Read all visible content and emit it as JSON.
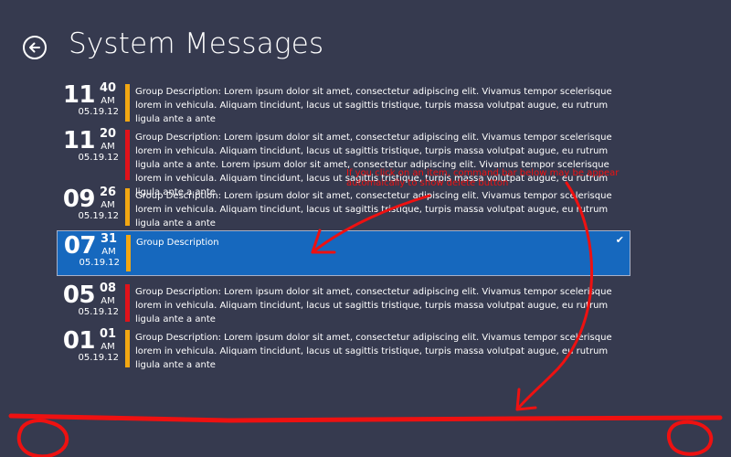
{
  "header": {
    "title": "System Messages",
    "back_icon": "back-arrow-icon"
  },
  "colors": {
    "background": "#363a4f",
    "selected": "#1668be",
    "amber": "#f3a712",
    "red": "#e0121a",
    "annotation": "#ee1111"
  },
  "messages": [
    {
      "hour": "11",
      "minute": "40",
      "ampm": "AM",
      "date": "05.19.12",
      "bar_color": "#f3a712",
      "selected": false,
      "description": "Group Description: Lorem ipsum dolor sit amet, consectetur adipiscing elit. Vivamus tempor scelerisque lorem in vehicula. Aliquam tincidunt, lacus ut sagittis tristique, turpis massa volutpat augue, eu rutrum ligula ante a ante"
    },
    {
      "hour": "11",
      "minute": "20",
      "ampm": "AM",
      "date": "05.19.12",
      "bar_color": "#e0121a",
      "selected": false,
      "description": "Group Description: Lorem ipsum dolor sit amet, consectetur adipiscing elit. Vivamus tempor scelerisque lorem in vehicula. Aliquam tincidunt, lacus ut sagittis tristique, turpis massa volutpat augue, eu rutrum ligula ante a ante.  Lorem ipsum dolor sit amet, consectetur adipiscing elit. Vivamus tempor scelerisque lorem in vehicula. Aliquam tincidunt, lacus ut sagittis tristique, turpis massa volutpat augue, eu rutrum ligula ante a ante"
    },
    {
      "hour": "09",
      "minute": "26",
      "ampm": "AM",
      "date": "05.19.12",
      "bar_color": "#f3a712",
      "selected": false,
      "description": "Group Description: Lorem ipsum dolor sit amet, consectetur adipiscing elit. Vivamus tempor scelerisque lorem in vehicula. Aliquam tincidunt, lacus ut sagittis tristique, turpis massa volutpat augue, eu rutrum ligula ante a ante"
    },
    {
      "hour": "07",
      "minute": "31",
      "ampm": "AM",
      "date": "05.19.12",
      "bar_color": "#f3a712",
      "selected": true,
      "description": "Group Description"
    },
    {
      "hour": "05",
      "minute": "08",
      "ampm": "AM",
      "date": "05.19.12",
      "bar_color": "#e0121a",
      "selected": false,
      "description": "Group Description: Lorem ipsum dolor sit amet, consectetur adipiscing elit. Vivamus tempor scelerisque lorem in vehicula. Aliquam tincidunt, lacus ut sagittis tristique, turpis massa volutpat augue, eu rutrum ligula ante a ante"
    },
    {
      "hour": "01",
      "minute": "01",
      "ampm": "AM",
      "date": "05.19.12",
      "bar_color": "#f3a712",
      "selected": false,
      "description": "Group Description: Lorem ipsum dolor sit amet, consectetur adipiscing elit. Vivamus tempor scelerisque lorem in vehicula. Aliquam tincidunt, lacus ut sagittis tristique, turpis massa volutpat augue, eu rutrum ligula ante a ante"
    }
  ],
  "annotation": {
    "text": "If you click on an item, command bar below may be appear automaically to show delete button"
  }
}
